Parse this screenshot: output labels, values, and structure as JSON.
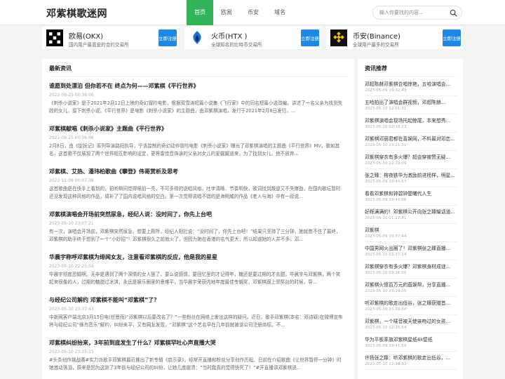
{
  "site": {
    "title": "邓紫棋歌迷网"
  },
  "nav": [
    {
      "label": "首页",
      "active": true
    },
    {
      "label": "欧易"
    },
    {
      "label": "币安"
    },
    {
      "label": "域名"
    }
  ],
  "search": {
    "placeholder": "输入你要找的内容..."
  },
  "exchanges": [
    {
      "name": "欧易(OKX)",
      "desc": "国内用户最喜爱的合约交易所",
      "button": "立即注册",
      "logo": "okx-logo"
    },
    {
      "name": "火币(HTX )",
      "desc": "全球知名的比特币交易所",
      "button": "立即注册",
      "logo": "htx-logo"
    },
    {
      "name": "币安(Binance)",
      "desc": "全球用户最多的交易所",
      "button": "立即注册",
      "logo": "binance-logo"
    }
  ],
  "latest": {
    "heading": "最新资讯",
    "articles": [
      {
        "title": "谁愿到处漂泊 但你若不在 终点为何——邓紫棋《平行世界》",
        "time": "2022-08-25 00:36:06",
        "excerpt": "《刺杀小说家》是于2021年2月12日上映的奇幻冒险电影，根据双雪涛短篇小说集《飞行家》中的同名短篇小说改编。讲述了一名父亲为找到失踪的女儿，接下刺杀小说。《平行世界》是电影《刺杀小说家》的主题曲，由邓紫棋演唱，发行于2021年2月8日发行。..."
      },
      {
        "title": "邓紫棋献唱《刺杀小说家》主题曲《平行世界》",
        "time": "2022-08-25 00:36:06",
        "excerpt": "2月8日，由《捉妖记》系列导演路阳执导，宁浩监制的奇幻动作冒险电影《刺杀小说家》曝光了邓紫棋演唱的主题曲《平行世界》MV。歌如其名，这首歌不仅展现了两个世界相互影响的设定，更将雷佳音饰演的父亲对女儿的爱娓娓道来，为了找到女儿，他不放弃..."
      },
      {
        "title": "邓紫棋、艾热、潘玮柏歌曲《攀登》伟哥赏析及思考",
        "time": "2022-11-09 00:07:38",
        "excerpt": "这首歌曲是在快手上看到的，初听瞬间觉得眼前一亮，不可多得的说唱风格，吐字清晰、节奏明快，歌词找到叛逆又不失撑劲，在国内歌坛暂时还没发现这种风格的作品，填补了了国内说唱风格的空白。第一次觉得说唱不错的是海明威的作品《老人与海》中有一段说..."
      },
      {
        "title": "邓紫棋演唱会开场前突然尿急，经纪人说：没时间了，你先上台吧",
        "time": "2023-05-10 23:07:21",
        "excerpt": "有一次，演唱会开场前，邓紫棋突然尿急，想要上厕所，经纪人阻拦说：“没时间了，你先上台吧！”结果只坚持了三分钟，她就憋不住了最终，邓紫棋的助手终于想到了一个“小妙招”！邓紫棋很久之前就火了，但因为她在香港的名气更大，所以知道她的人并不多。邓..."
      },
      {
        "title": "华晨宇称呼邓紫棋为绯闻女友，注意看邓紫棋的反应，他是我的星星",
        "time": "2023-05-10 22:25:59",
        "excerpt": "华晨宇彻底恐婚啊。无非是遇到了两个深情的女人罢了，要么说感情，要回忆里的才记得年，糖还是要过期的才去甜，华晨宇与邓紫棋，两个笑起来很像的人，过期的糖甜过冰淇，永远是娱乐圈里的意难平，当华晨宇荣获内地年度最佳专辑奖，邓紫棋跟上领奖台的时候，导..."
      },
      {
        "title": "与经纪公司解约 邓紫棋不能叫“邓紫棋”了？",
        "time": "2023-05-10 23:37:43",
        "excerpt": "中新网客户端北京3月15日电(任思雨)“邓紫棋以后要改名了？”一些粉丝在网络上发出这样的疑问。近日，歌手邓紫棋(本名：邓诗颖)在微博宣布将与经纪公司“蜂鸟音乐”解约，纠纷未平，又有网友发现，“邓紫棋”这个艺名早在几年前就被该公司注册商标。不..."
      },
      {
        "title": "邓紫棋纠纷抬来，3年前到底发生了什么？邓紫棋罕吐心声直播大哭",
        "time": "2023-05-10 23:25:15",
        "excerpt": "#头条创作挑战赛#实力派歌手邓紫棋最近推出了新专辑《启示录》，经常开直播和粉丝分享创作历程。日前在介绍歌曲《让世界暂停一分钟》时她激动落泪，原来是因为这到了3年前与经纪公司的纠纷，让她几度崩溃：“当时我真的觉得快死了！”#开直播讲邓紫棋说..."
      }
    ]
  },
  "recommend": {
    "heading": "资讯推荐",
    "items": [
      {
        "title": "邓超陈赫邓紫棋合唱惊艳，五哈演唱会...",
        "date": "2023-05-09 19:32:43"
      },
      {
        "title": "五哈拍出了演唱会群视频，邓超陈赫...",
        "date": "2023-05-10 12:01:31"
      },
      {
        "title": "邓紫棋演唱会现场托起鲸尾，本来想秀...",
        "date": "2023-05-10 02:18:23"
      },
      {
        "title": "邓紫棋邓丽君都在喜娱网，不料最对邓恋...",
        "date": "2023-05-10 23:21:31"
      },
      {
        "title": "邓紫棋穿衣有多火爆？超会穿被赞无疑...",
        "date": "2023-05-10 22:19:09"
      },
      {
        "title": "张之臻：榕夜铁华为激励前进榜样，明星...",
        "date": "2023-05-09 19:44:57"
      },
      {
        "title": "看看邓紫棋和钟碧钟楚曦代人生",
        "date": "2023-05-09 19:43:06"
      },
      {
        "title": "好辉满满的！邓紫棋公开向张之臻耀话道...",
        "date": "2023-05-10 01:27:41"
      },
      {
        "title": "邓紫棋",
        "date": "2023-05-09 19:37:44"
      },
      {
        "title": "中国男网火出圈了！邓紫棋张之臻直播...",
        "date": "2023-05-10 03:37:14"
      },
      {
        "title": "邓紫棋穿衣有多火爆？邓紫棋身材成谜...",
        "date": "2023-05-10 03:16:05"
      },
      {
        "title": "邓紫棋火憶百万元的直娱帮，分享直播...",
        "date": "2023-05-10 23:29:05"
      },
      {
        "title": "听邓紫棋的歌走出低谷，张之臻获赠首...",
        "date": "2023-05-10 23:19:00"
      },
      {
        "title": "邓紫棋，一个唛音被天使亲吻过的女孩...",
        "date": "2023-05-10 22:35:54"
      },
      {
        "title": "华为平板率旗邓紫棋星纸4k壁纸",
        "date": "2023-05-09 19:41:59"
      },
      {
        "title": "许扬张之臻：听邓紫棋的歌走出低谷，...",
        "date": "2023-05-10 22:38:33"
      }
    ]
  }
}
